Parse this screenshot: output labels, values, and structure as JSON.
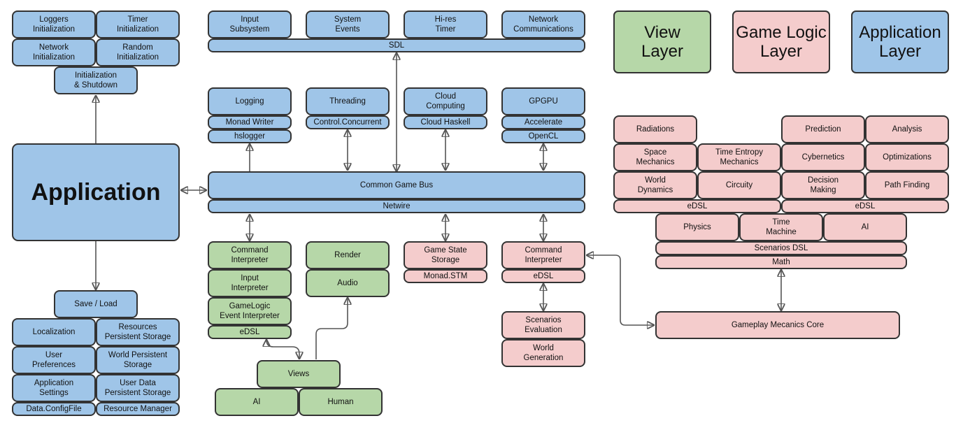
{
  "legend": {
    "view": "View\nLayer",
    "game_logic": "Game Logic\nLayer",
    "application": "Application\nLayer"
  },
  "colors": {
    "application_layer": "#9fc5e8",
    "game_logic_layer": "#f4cccc",
    "view_layer": "#b6d7a8",
    "border": "#333333"
  },
  "init": {
    "loggers": "Loggers\nInitialization",
    "timer": "Timer\nInitialization",
    "network": "Network\nInitialization",
    "random": "Random\nInitialization",
    "init_shutdown": "Initialization\n& Shutdown"
  },
  "application": "Application",
  "sdl": {
    "input": "Input\nSubsystem",
    "events": "System\nEvents",
    "timer": "Hi-res\nTimer",
    "network": "Network\nCommunications",
    "sdl": "SDL"
  },
  "services": {
    "logging": "Logging",
    "monad_writer": "Monad Writer",
    "hslogger": "hslogger",
    "threading": "Threading",
    "control_concurrent": "Control.Concurrent",
    "cloud": "Cloud\nComputing",
    "cloud_haskell": "Cloud Haskell",
    "gpgpu": "GPGPU",
    "accelerate": "Accelerate",
    "opencl": "OpenCL"
  },
  "bus": {
    "common": "Common Game Bus",
    "netwire": "Netwire"
  },
  "view": {
    "command_interpreter": "Command\nInterpreter",
    "input_interpreter": "Input\nInterpreter",
    "gamelogic_event": "GameLogic\nEvent Interpreter",
    "edsl": "eDSL",
    "render": "Render",
    "audio": "Audio",
    "views": "Views",
    "ai": "AI",
    "human": "Human"
  },
  "logic": {
    "game_state": "Game State\nStorage",
    "monad_stm": "Monad.STM",
    "command_interpreter": "Command\nInterpreter",
    "edsl": "eDSL",
    "scenarios_eval": "Scenarios\nEvaluation",
    "world_gen": "World\nGeneration"
  },
  "mechanics": {
    "radiations": "Radiations",
    "prediction": "Prediction",
    "analysis": "Analysis",
    "space": "Space\nMechanics",
    "time_entropy": "Time Entropy\nMechanics",
    "cybernetics": "Cybernetics",
    "optimizations": "Optimizations",
    "world_dynamics": "World\nDynamics",
    "circuity": "Circuity",
    "decision": "Decision\nMaking",
    "path_finding": "Path Finding",
    "edsl_left": "eDSL",
    "edsl_right": "eDSL",
    "physics": "Physics",
    "time_machine": "Time\nMachine",
    "ai": "AI",
    "scenarios_dsl": "Scenarios DSL",
    "math": "Math",
    "core": "Gameplay Mecanics Core"
  },
  "storage": {
    "save_load": "Save / Load",
    "localization": "Localization",
    "resources": "Resources\nPersistent Storage",
    "user_prefs": "User\nPreferences",
    "world_storage": "World Persistent\nStorage",
    "app_settings": "Application\nSettings",
    "user_data": "User Data\nPersistent Storage",
    "config_file": "Data.ConfigFile",
    "resource_manager": "Resource Manager"
  }
}
